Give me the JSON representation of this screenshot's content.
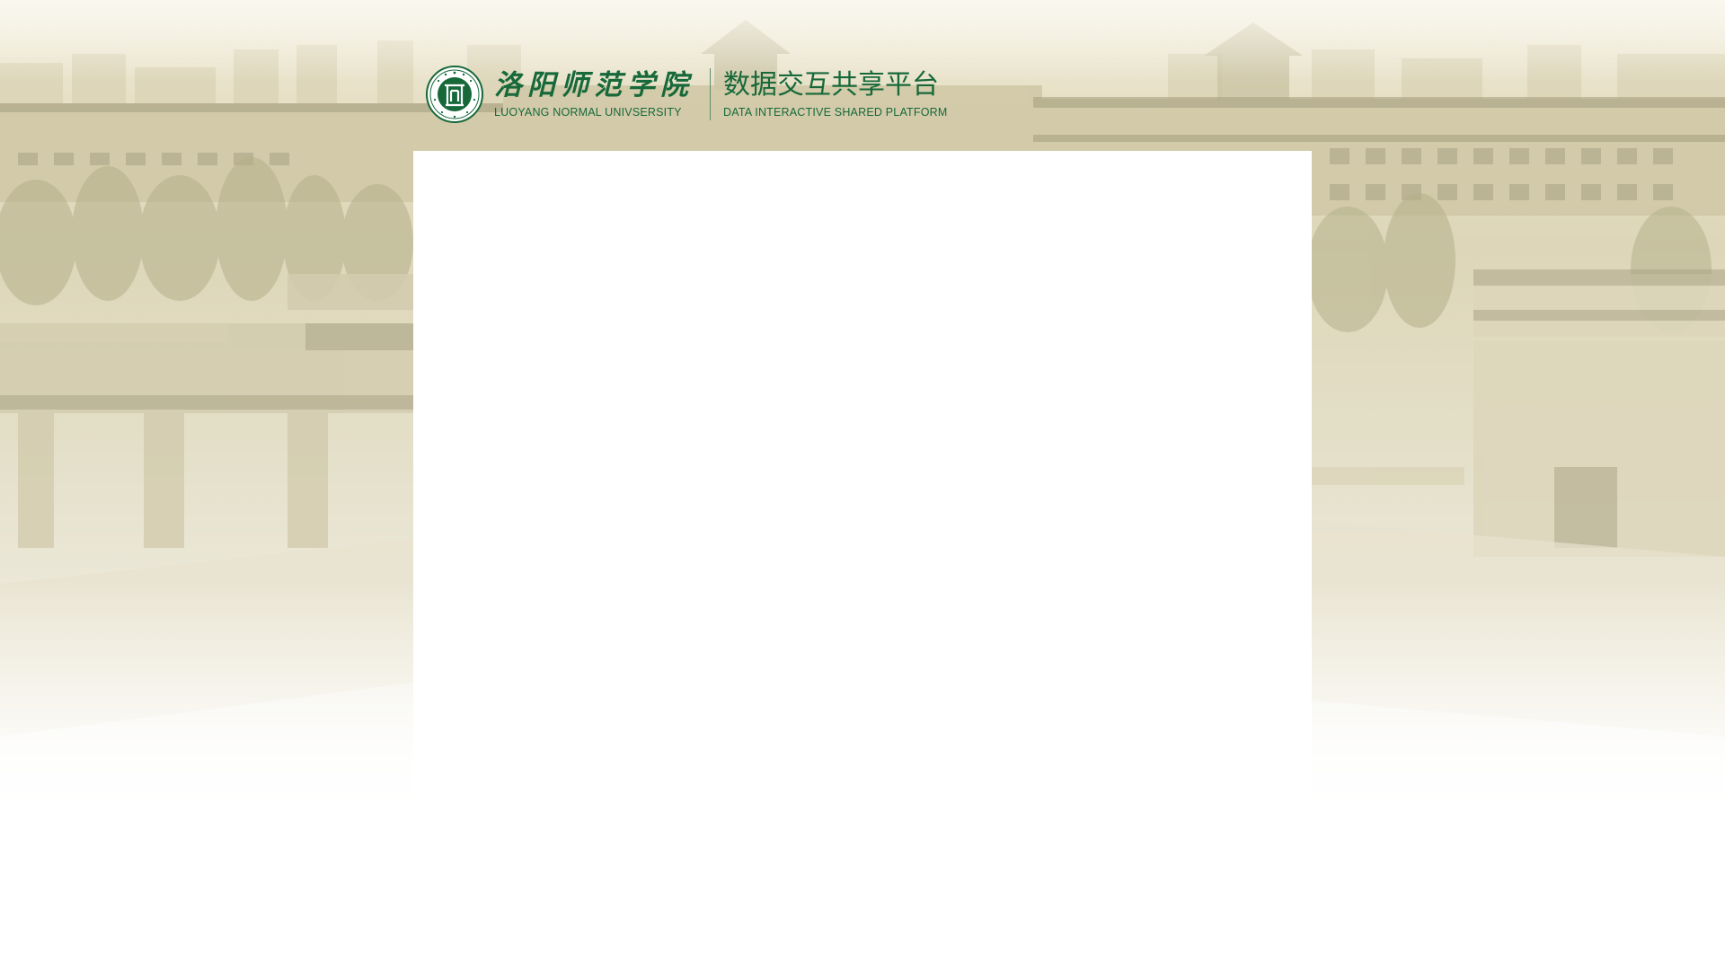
{
  "header": {
    "school_name_cn": "洛阳师范学院",
    "school_name_en": "LUOYANG NORMAL UNIVSERSITY",
    "platform_name_cn": "数据交互共享平台",
    "platform_name_en": "DATA INTERACTIVE SHARED PLATFORM"
  },
  "icons": {
    "logo": "university-seal-icon"
  },
  "colors": {
    "brand_green": "#17693a",
    "background_tint": "#e4dcc0",
    "panel": "#ffffff"
  }
}
